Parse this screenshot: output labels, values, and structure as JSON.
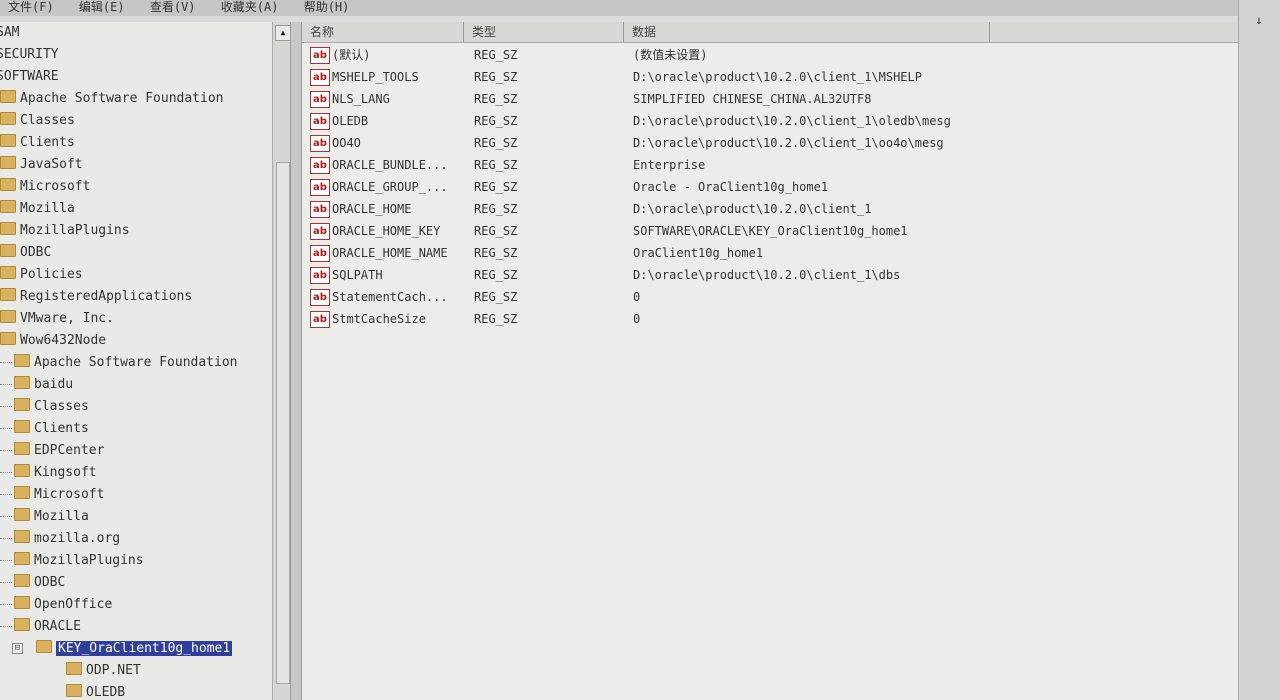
{
  "menu": [
    "文件(F)",
    "编辑(E)",
    "查看(V)",
    "收藏夹(A)",
    "帮助(H)"
  ],
  "tree": {
    "top_keys": [
      "SAM",
      "SECURITY",
      "SOFTWARE"
    ],
    "software_children": [
      "Apache Software Foundation",
      "Classes",
      "Clients",
      "JavaSoft",
      "Microsoft",
      "Mozilla",
      "MozillaPlugins",
      "ODBC",
      "Policies",
      "RegisteredApplications",
      "VMware, Inc.",
      "Wow6432Node"
    ],
    "wow_children": [
      "Apache Software Foundation",
      "baidu",
      "Classes",
      "Clients",
      "EDPCenter",
      "Kingsoft",
      "Microsoft",
      "Mozilla",
      "mozilla.org",
      "MozillaPlugins",
      "ODBC",
      "OpenOffice",
      "ORACLE"
    ],
    "selected_key": "KEY_OraClient10g_home1",
    "oracle_sub": [
      "ODP.NET",
      "OLEDB"
    ]
  },
  "columns": {
    "name": "名称",
    "type": "类型",
    "data": "数据"
  },
  "values": [
    {
      "name": "(默认)",
      "type": "REG_SZ",
      "data": "(数值未设置)"
    },
    {
      "name": "MSHELP_TOOLS",
      "type": "REG_SZ",
      "data": "D:\\oracle\\product\\10.2.0\\client_1\\MSHELP"
    },
    {
      "name": "NLS_LANG",
      "type": "REG_SZ",
      "data": "SIMPLIFIED CHINESE_CHINA.AL32UTF8"
    },
    {
      "name": "OLEDB",
      "type": "REG_SZ",
      "data": "D:\\oracle\\product\\10.2.0\\client_1\\oledb\\mesg"
    },
    {
      "name": "OO4O",
      "type": "REG_SZ",
      "data": "D:\\oracle\\product\\10.2.0\\client_1\\oo4o\\mesg"
    },
    {
      "name": "ORACLE_BUNDLE...",
      "type": "REG_SZ",
      "data": "Enterprise"
    },
    {
      "name": "ORACLE_GROUP_...",
      "type": "REG_SZ",
      "data": "Oracle - OraClient10g_home1"
    },
    {
      "name": "ORACLE_HOME",
      "type": "REG_SZ",
      "data": "D:\\oracle\\product\\10.2.0\\client_1"
    },
    {
      "name": "ORACLE_HOME_KEY",
      "type": "REG_SZ",
      "data": "SOFTWARE\\ORACLE\\KEY_OraClient10g_home1"
    },
    {
      "name": "ORACLE_HOME_NAME",
      "type": "REG_SZ",
      "data": "OraClient10g_home1"
    },
    {
      "name": "SQLPATH",
      "type": "REG_SZ",
      "data": "D:\\oracle\\product\\10.2.0\\client_1\\dbs"
    },
    {
      "name": "StatementCach...",
      "type": "REG_SZ",
      "data": "0"
    },
    {
      "name": "StmtCacheSize",
      "type": "REG_SZ",
      "data": "0"
    }
  ],
  "icons": {
    "value_icon": "ab",
    "folder": "folder-icon",
    "collapse": "⊟",
    "scroll_down": "↓",
    "scroll_up": "▲"
  }
}
